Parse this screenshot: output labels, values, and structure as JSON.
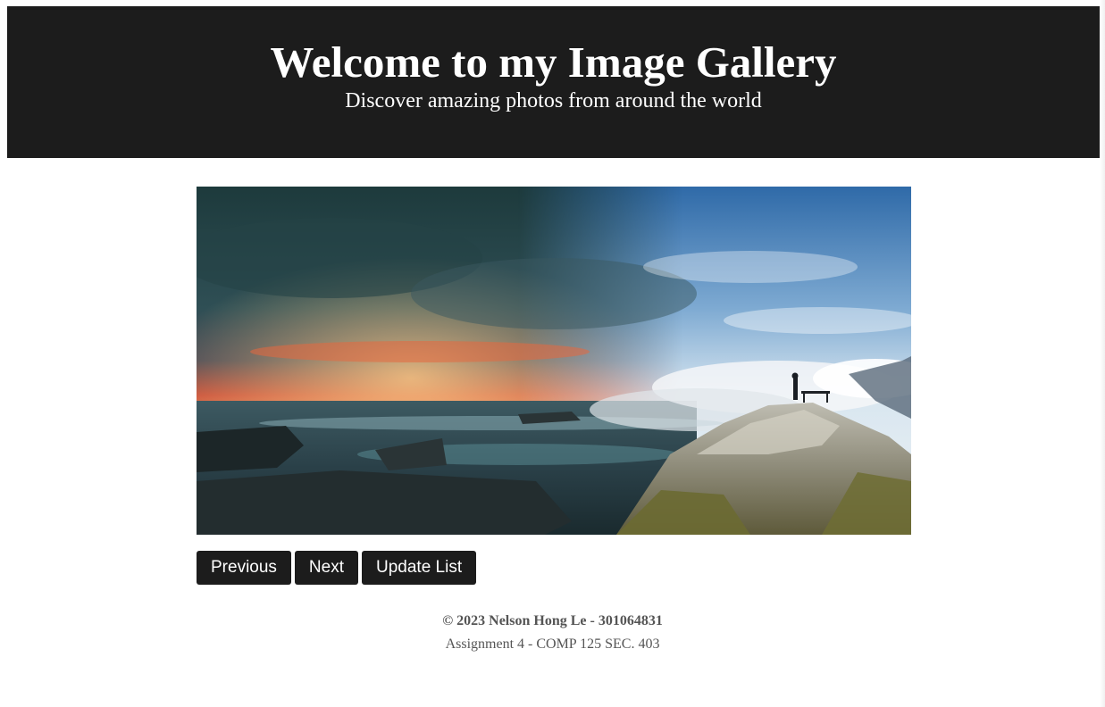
{
  "header": {
    "title": "Welcome to my Image Gallery",
    "subtitle": "Discover amazing photos from around the world"
  },
  "gallery": {
    "image_subject": "split-landscape-photo"
  },
  "controls": {
    "previous_label": "Previous",
    "next_label": "Next",
    "update_label": "Update List"
  },
  "footer": {
    "copyright": "© 2023 Nelson Hong Le - 301064831",
    "assignment": "Assignment 4 - COMP 125 SEC. 403"
  },
  "colors": {
    "header_bg": "#1c1c1c",
    "button_bg": "#1c1c1c",
    "button_text": "#ffffff",
    "footer_text": "#555555"
  }
}
